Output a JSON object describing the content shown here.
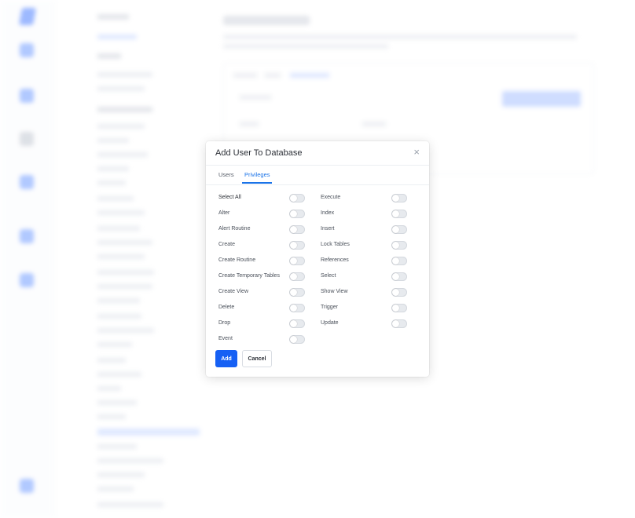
{
  "modal": {
    "title": "Add User To Database",
    "close_glyph": "×",
    "tabs": [
      {
        "label": "Users",
        "active": false
      },
      {
        "label": "Privileges",
        "active": true
      }
    ],
    "privileges_left": [
      {
        "label": "Select All",
        "enabled": false
      },
      {
        "label": "Alter",
        "enabled": false
      },
      {
        "label": "Alert Routine",
        "enabled": false
      },
      {
        "label": "Create",
        "enabled": false
      },
      {
        "label": "Create Routine",
        "enabled": false
      },
      {
        "label": "Create Temporary Tables",
        "enabled": false
      },
      {
        "label": "Create View",
        "enabled": false
      },
      {
        "label": "Delete",
        "enabled": false
      },
      {
        "label": "Drop",
        "enabled": false
      },
      {
        "label": "Event",
        "enabled": false
      }
    ],
    "privileges_right": [
      {
        "label": "Execute",
        "enabled": false
      },
      {
        "label": "Index",
        "enabled": false
      },
      {
        "label": "Insert",
        "enabled": false
      },
      {
        "label": "Lock Tables",
        "enabled": false
      },
      {
        "label": "References",
        "enabled": false
      },
      {
        "label": "Select",
        "enabled": false
      },
      {
        "label": "Show View",
        "enabled": false
      },
      {
        "label": "Trigger",
        "enabled": false
      },
      {
        "label": "Update",
        "enabled": false
      }
    ],
    "add_label": "Add",
    "cancel_label": "Cancel"
  },
  "colors": {
    "accent": "#1660f4",
    "tab_active": "#1a73e8",
    "toggle_off": "#e7eaee"
  }
}
